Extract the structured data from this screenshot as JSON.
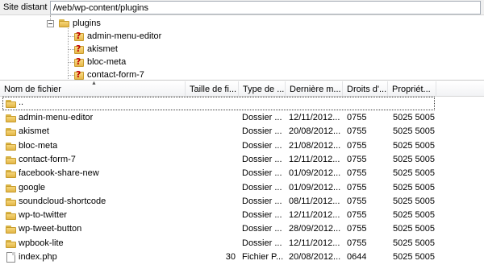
{
  "remote_site": {
    "label": "Site distant :",
    "path": "/web/wp-content/plugins"
  },
  "tree": {
    "parent": "plugins",
    "children": [
      "admin-menu-editor",
      "akismet",
      "bloc-meta",
      "contact-form-7"
    ]
  },
  "columns": [
    {
      "label": "Nom de fichier"
    },
    {
      "label": "Taille de fi..."
    },
    {
      "label": "Type de ..."
    },
    {
      "label": "Dernière m..."
    },
    {
      "label": "Droits d'..."
    },
    {
      "label": "Propriét..."
    }
  ],
  "parent_entry": "..",
  "rows": [
    {
      "name": "admin-menu-editor",
      "size": "",
      "type": "Dossier ...",
      "modified": "12/11/2012...",
      "perms": "0755",
      "owner": "5025 5005",
      "icon": "folder-icon"
    },
    {
      "name": "akismet",
      "size": "",
      "type": "Dossier ...",
      "modified": "20/08/2012...",
      "perms": "0755",
      "owner": "5025 5005",
      "icon": "folder-icon"
    },
    {
      "name": "bloc-meta",
      "size": "",
      "type": "Dossier ...",
      "modified": "21/08/2012...",
      "perms": "0755",
      "owner": "5025 5005",
      "icon": "folder-icon"
    },
    {
      "name": "contact-form-7",
      "size": "",
      "type": "Dossier ...",
      "modified": "12/11/2012...",
      "perms": "0755",
      "owner": "5025 5005",
      "icon": "folder-icon"
    },
    {
      "name": "facebook-share-new",
      "size": "",
      "type": "Dossier ...",
      "modified": "01/09/2012...",
      "perms": "0755",
      "owner": "5025 5005",
      "icon": "folder-icon"
    },
    {
      "name": "google",
      "size": "",
      "type": "Dossier ...",
      "modified": "01/09/2012...",
      "perms": "0755",
      "owner": "5025 5005",
      "icon": "folder-icon"
    },
    {
      "name": "soundcloud-shortcode",
      "size": "",
      "type": "Dossier ...",
      "modified": "08/11/2012...",
      "perms": "0755",
      "owner": "5025 5005",
      "icon": "folder-icon"
    },
    {
      "name": "wp-to-twitter",
      "size": "",
      "type": "Dossier ...",
      "modified": "12/11/2012...",
      "perms": "0755",
      "owner": "5025 5005",
      "icon": "folder-icon"
    },
    {
      "name": "wp-tweet-button",
      "size": "",
      "type": "Dossier ...",
      "modified": "28/09/2012...",
      "perms": "0755",
      "owner": "5025 5005",
      "icon": "folder-icon"
    },
    {
      "name": "wpbook-lite",
      "size": "",
      "type": "Dossier ...",
      "modified": "12/11/2012...",
      "perms": "0755",
      "owner": "5025 5005",
      "icon": "folder-icon"
    },
    {
      "name": "index.php",
      "size": "30",
      "type": "Fichier P...",
      "modified": "20/08/2012...",
      "perms": "0644",
      "owner": "5025 5005",
      "icon": "file-icon"
    }
  ]
}
